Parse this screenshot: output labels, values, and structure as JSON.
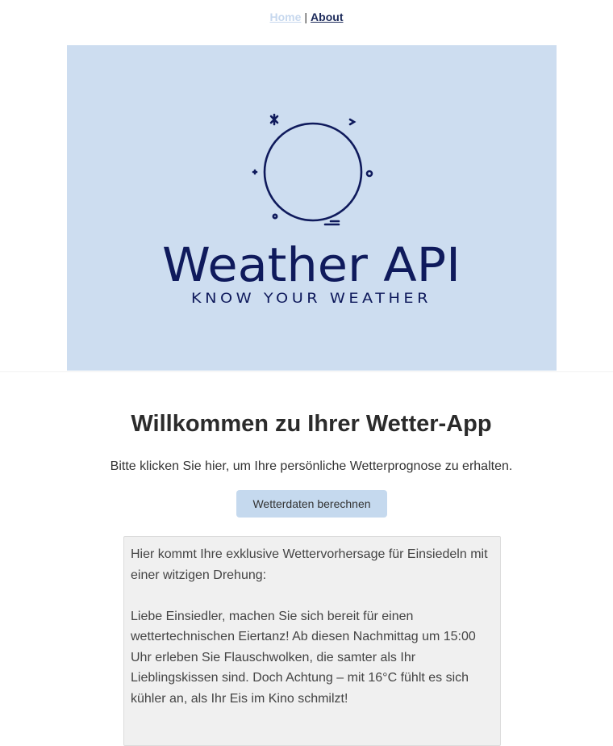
{
  "nav": {
    "home_label": "Home",
    "separator": "|",
    "about_label": "About"
  },
  "banner": {
    "title": "Weather API",
    "tagline": "KNOW YOUR WEATHER",
    "background_color": "#cdddf0",
    "ink_color": "#0f1a5c"
  },
  "main": {
    "heading": "Willkommen zu Ihrer Wetter-App",
    "intro": "Bitte klicken Sie hier, um Ihre persönliche Wetterprognose zu erhalten.",
    "button_label": "Wetterdaten berechnen"
  },
  "forecast": {
    "paragraphs": [
      "Hier kommt Ihre exklusive Wettervorhersage für Einsiedeln mit einer witzigen Drehung:",
      "Liebe Einsiedler, machen Sie sich bereit für einen wettertechnischen Eiertanz! Ab diesen Nachmittag um 15:00 Uhr erleben Sie Flauschwolken, die samter als Ihr Lieblingskissen sind. Doch Achtung – mit 16°C fühlt es sich kühler an, als Ihr Eis im Kino schmilzt!"
    ]
  }
}
